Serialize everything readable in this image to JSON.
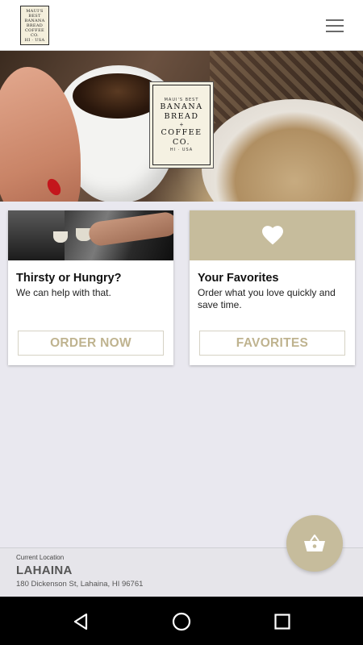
{
  "header": {
    "logo": {
      "line1": "MAUI'S BEST",
      "line2": "BANANA",
      "line3": "BREAD",
      "line4": "COFFEE",
      "line5": "CO.",
      "line6": "HI · USA"
    },
    "menu_icon": "hamburger-menu-icon"
  },
  "hero": {
    "logo": {
      "tagline": "MAUI'S BEST",
      "line1": "BANANA",
      "line2": "BREAD",
      "plus": "+",
      "line3": "COFFEE",
      "line4": "CO.",
      "footer": "HI · USA"
    }
  },
  "cards": [
    {
      "title": "Thirsty or Hungry?",
      "subtitle": "We can help with that.",
      "button": "ORDER NOW"
    },
    {
      "icon": "heart-icon",
      "title": "Your Favorites",
      "subtitle": "Order what you love quickly and save time.",
      "button": "FAVORITES"
    }
  ],
  "cart_fab": {
    "icon": "basket-icon"
  },
  "location": {
    "caption": "Current Location",
    "name": "LAHAINA",
    "address": "180 Dickenson St, Lahaina, HI 96761"
  },
  "system_nav": {
    "back_icon": "back-triangle-icon",
    "home_icon": "home-circle-icon",
    "recents_icon": "recents-square-icon"
  },
  "colors": {
    "accent": "#c6bc9c",
    "button_text": "#bfb38f",
    "background": "#e9e8ef",
    "nav_bar": "#000000"
  }
}
